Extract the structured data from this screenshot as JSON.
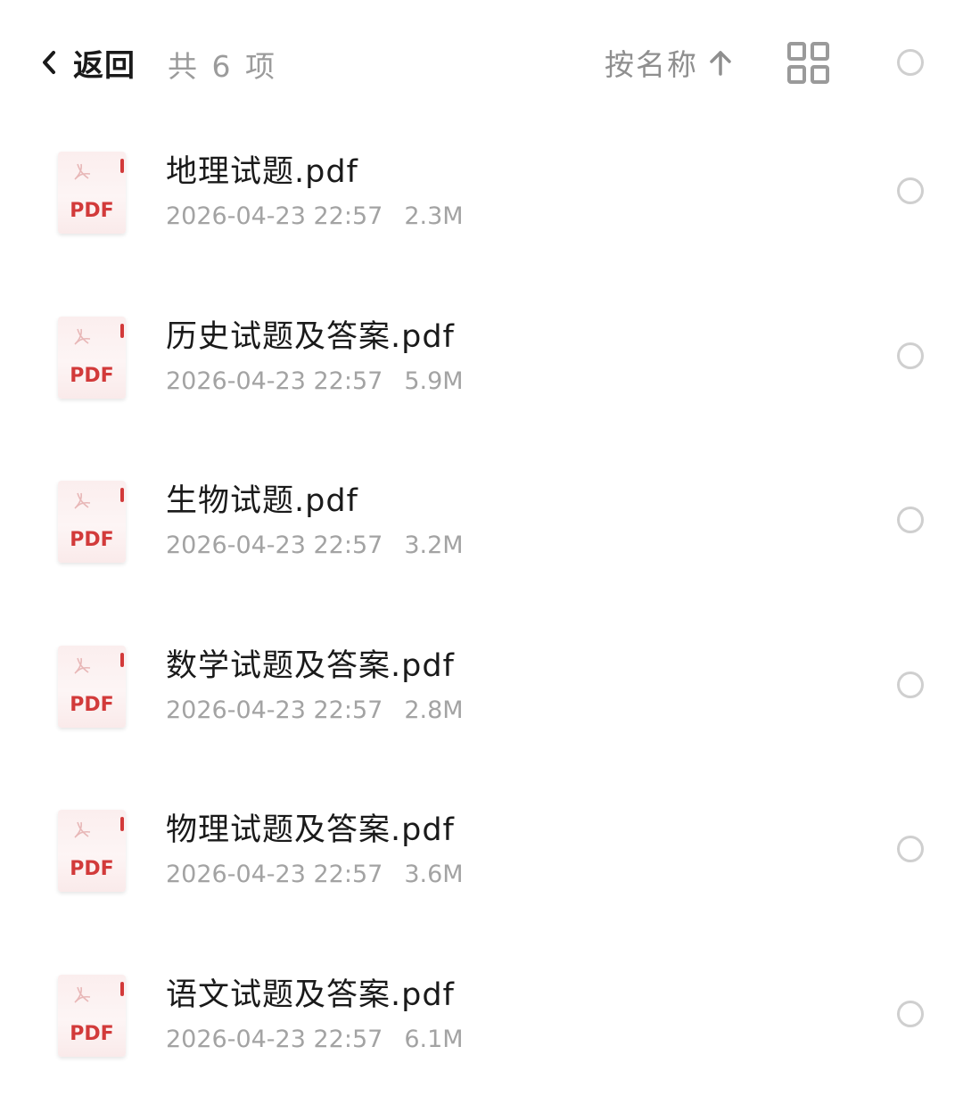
{
  "header": {
    "back_label": "返回",
    "count_label": "共 6 项",
    "sort_label": "按名称",
    "icons": {
      "back": "chevron-left-icon",
      "sort": "arrow-up-icon",
      "view": "grid-view-icon",
      "select_all": "select-circle-icon"
    }
  },
  "files": [
    {
      "name": "地理试题.pdf",
      "date": "2026-04-23 22:57",
      "size": "2.3M",
      "icon_label": "PDF"
    },
    {
      "name": "历史试题及答案.pdf",
      "date": "2026-04-23 22:57",
      "size": "5.9M",
      "icon_label": "PDF"
    },
    {
      "name": "生物试题.pdf",
      "date": "2026-04-23 22:57",
      "size": "3.2M",
      "icon_label": "PDF"
    },
    {
      "name": "数学试题及答案.pdf",
      "date": "2026-04-23 22:57",
      "size": "2.8M",
      "icon_label": "PDF"
    },
    {
      "name": "物理试题及答案.pdf",
      "date": "2026-04-23 22:57",
      "size": "3.6M",
      "icon_label": "PDF"
    },
    {
      "name": "语文试题及答案.pdf",
      "date": "2026-04-23 22:57",
      "size": "6.1M",
      "icon_label": "PDF"
    }
  ],
  "colors": {
    "pdf_accent": "#d23a3a",
    "secondary_text": "#a3a3a3",
    "primary_text": "#1a1a1a",
    "circle_border": "#cfcfcf"
  }
}
